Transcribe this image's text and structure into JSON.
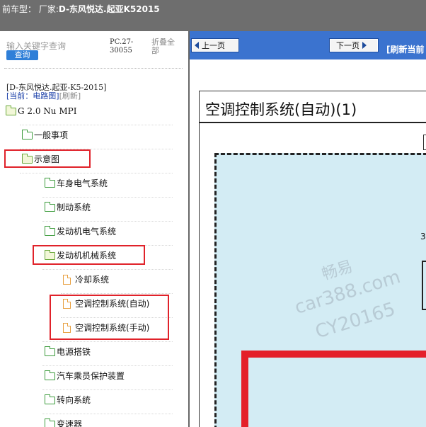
{
  "header": {
    "prefix": "前车型：",
    "maker": "厂家:",
    "model": "D-东风悦达.起亚K52015"
  },
  "search": {
    "placeholder": "输入关键字查询",
    "button": "查询",
    "pc": "PC.27-30055",
    "collapse": "折叠全部"
  },
  "tree_info": {
    "model_name": "[D-东风悦达.起亚-K5-2015]",
    "current": "[当前：电路图]",
    "refresh": "[刷新]"
  },
  "tree": [
    {
      "label": "G 2.0 Nu MPI",
      "icon": "folder-open-icon"
    },
    {
      "label": "一般事项",
      "icon": "folder-icon"
    },
    {
      "label": "示意图",
      "icon": "folder-open-icon"
    },
    {
      "label": "车身电气系统",
      "icon": "folder-icon"
    },
    {
      "label": "制动系统",
      "icon": "folder-icon"
    },
    {
      "label": "发动机电气系统",
      "icon": "folder-icon"
    },
    {
      "label": "发动机机械系统",
      "icon": "folder-open-icon"
    },
    {
      "label": "冷却系统",
      "icon": "document-icon"
    },
    {
      "label": "空调控制系统(自动)",
      "icon": "document-icon"
    },
    {
      "label": "空调控制系统(手动)",
      "icon": "document-icon"
    },
    {
      "label": "电源搭铁",
      "icon": "folder-icon"
    },
    {
      "label": "汽车乘员保护装置",
      "icon": "folder-icon"
    },
    {
      "label": "转向系统",
      "icon": "folder-icon"
    },
    {
      "label": "变速器",
      "icon": "folder-icon"
    }
  ],
  "nav": {
    "prev": "上一页",
    "next": "下一页",
    "refresh_current": "[刷新当前"
  },
  "document": {
    "title": "空调控制系统(自动)(1)",
    "label_3": "3"
  },
  "watermark": {
    "line1": "畅易",
    "line2": "car388.com",
    "line3": "CY20165"
  },
  "colors": {
    "highlight": "#e0222a",
    "nav_bar": "#3b73cf",
    "diagram_bg": "#d3ecf4",
    "header_bg": "#6e6e6e"
  }
}
